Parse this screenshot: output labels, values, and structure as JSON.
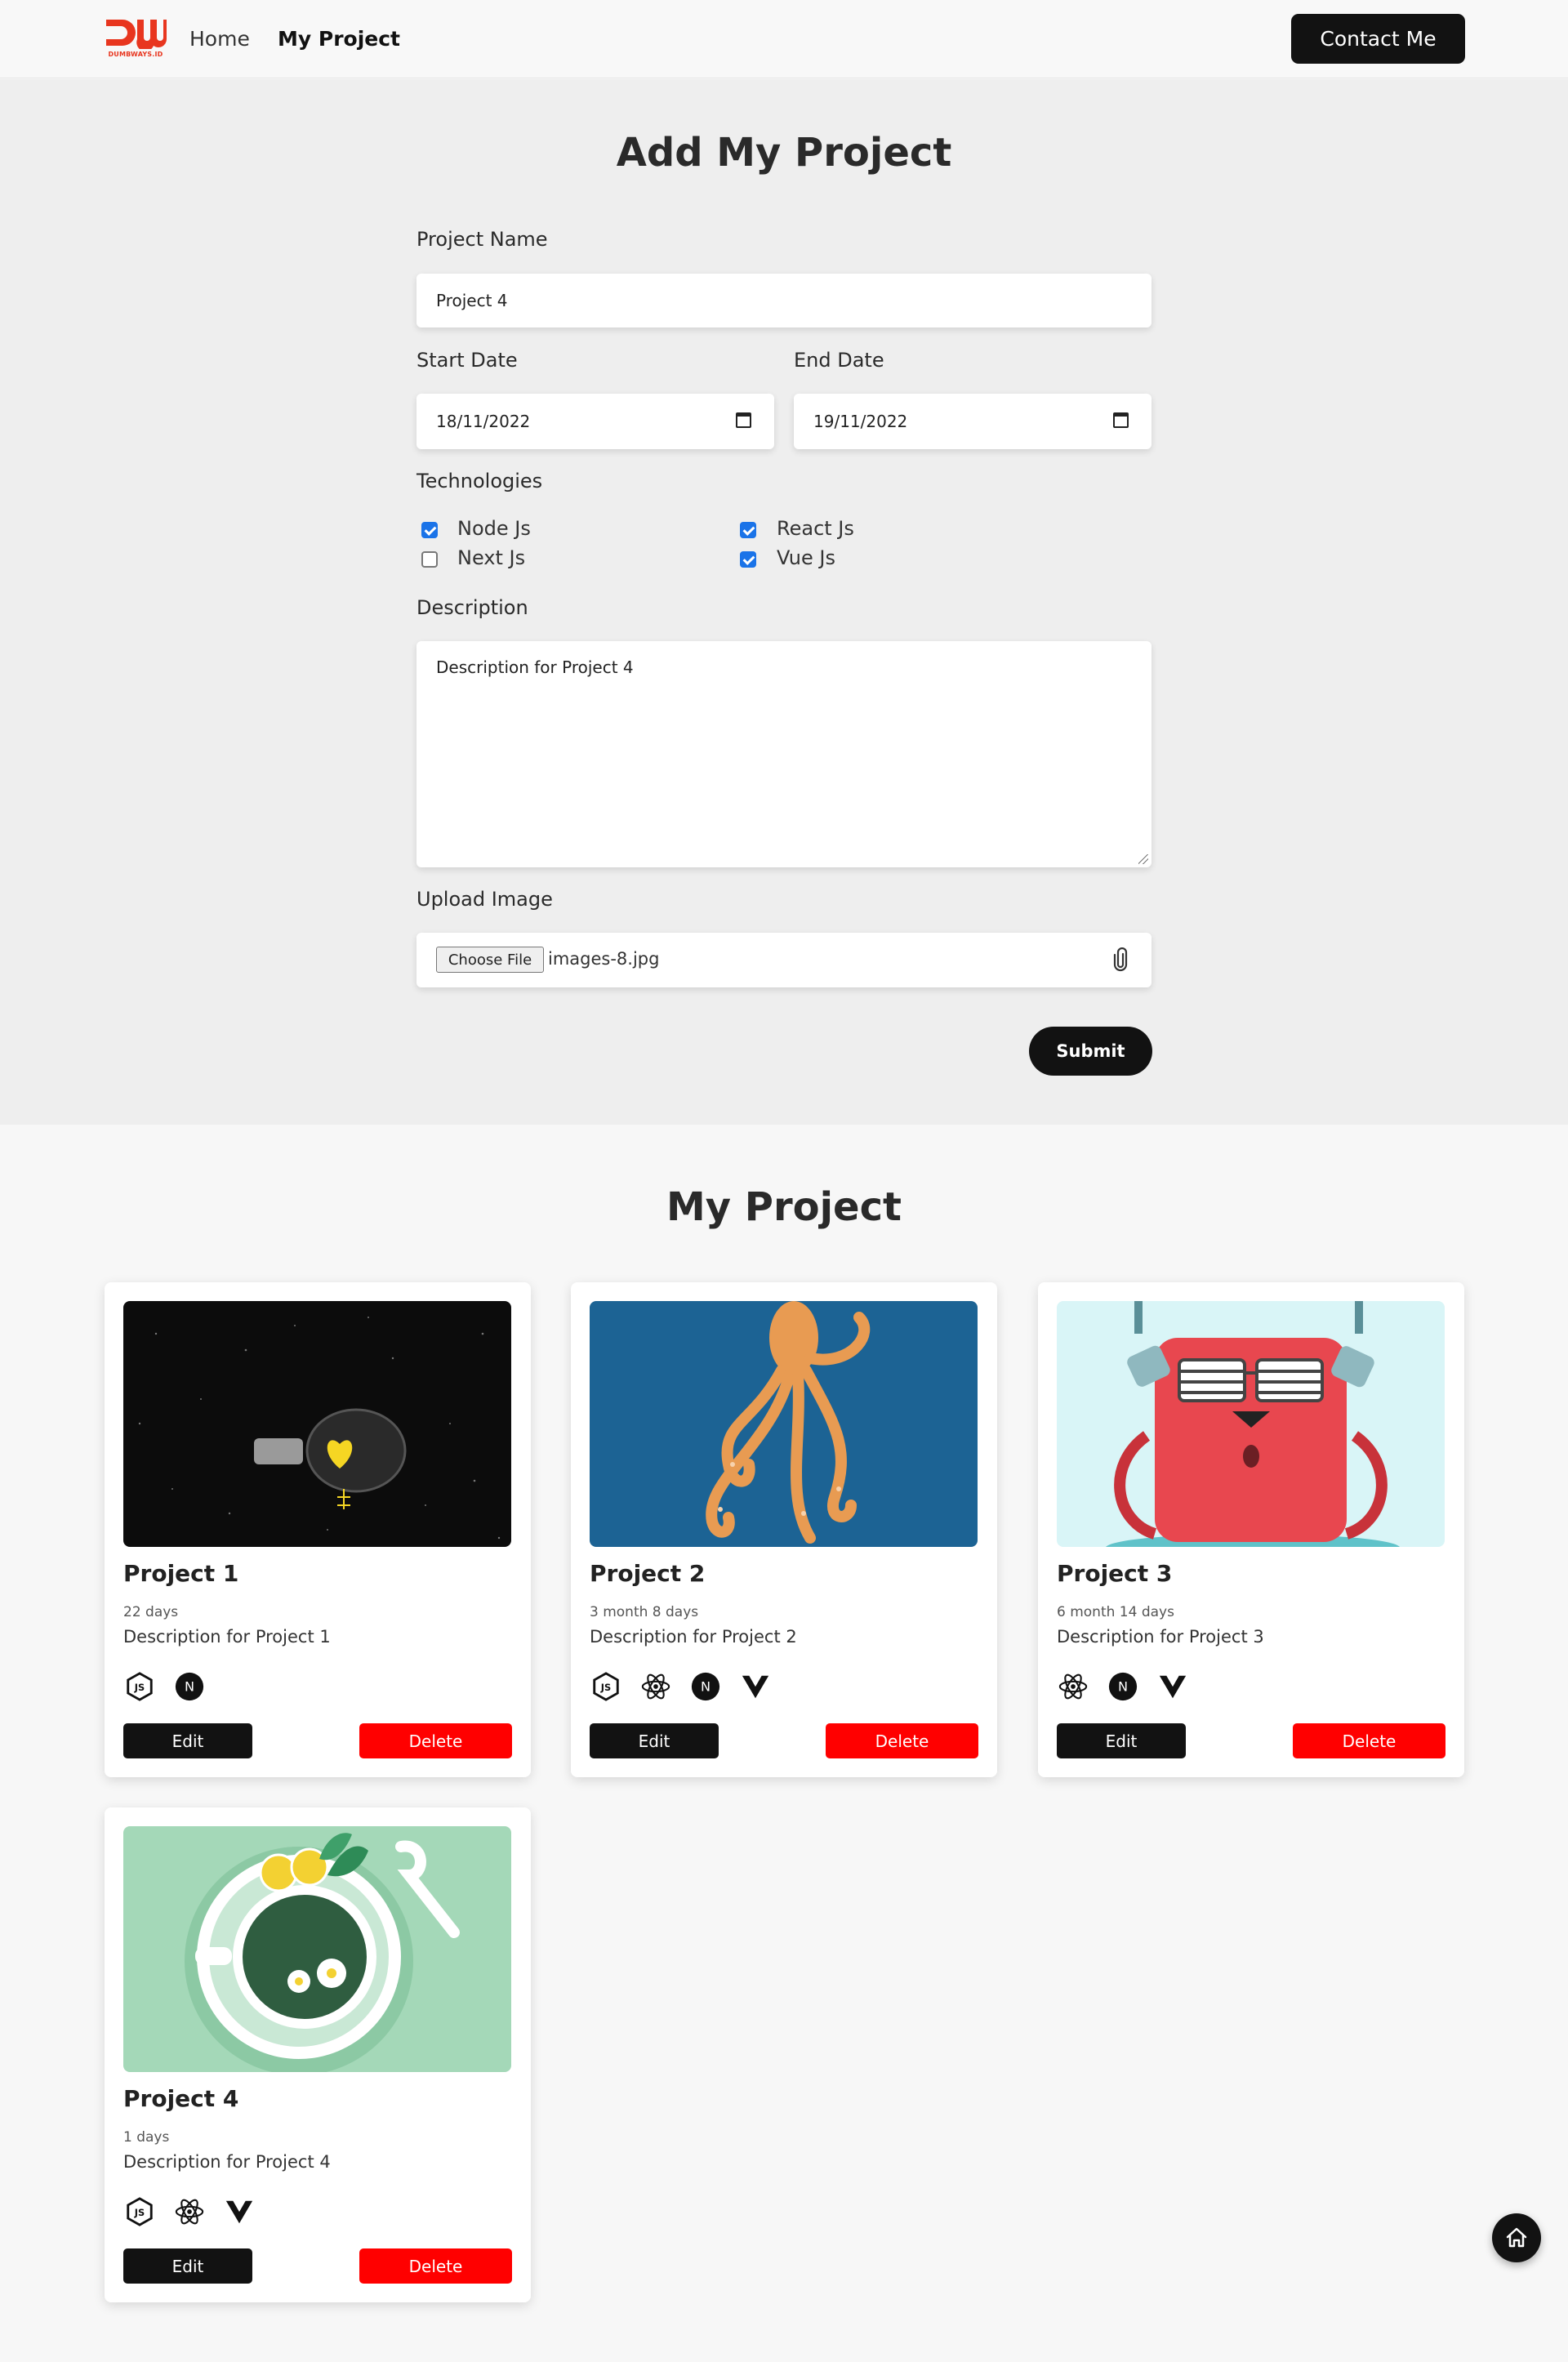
{
  "nav": {
    "logo_text": "DUMBWAYS.ID",
    "links": [
      {
        "label": "Home"
      },
      {
        "label": "My Project"
      }
    ],
    "contact_label": "Contact Me"
  },
  "form": {
    "title": "Add My Project",
    "project_name_label": "Project Name",
    "project_name_value": "Project 4",
    "start_date_label": "Start Date",
    "start_date_value": "18/11/2022",
    "end_date_label": "End Date",
    "end_date_value": "19/11/2022",
    "technologies_label": "Technologies",
    "technologies": [
      {
        "label": "Node Js",
        "checked": true
      },
      {
        "label": "React Js",
        "checked": true
      },
      {
        "label": "Next Js",
        "checked": false
      },
      {
        "label": "Vue Js",
        "checked": true
      }
    ],
    "description_label": "Description",
    "description_value": "Description for Project 4",
    "upload_label": "Upload Image",
    "choose_file_label": "Choose File",
    "file_name": "images-8.jpg",
    "submit_label": "Submit"
  },
  "projects": {
    "title": "My Project",
    "cards": [
      {
        "name": "Project 1",
        "duration": "22 days",
        "description": "Description for Project 1",
        "techs": [
          "node-js-icon",
          "next-js-icon"
        ],
        "edit": "Edit",
        "delete": "Delete"
      },
      {
        "name": "Project 2",
        "duration": "3 month 8 days",
        "description": "Description for Project 2",
        "techs": [
          "node-js-icon",
          "react-js-icon",
          "next-js-icon",
          "vue-js-icon"
        ],
        "edit": "Edit",
        "delete": "Delete"
      },
      {
        "name": "Project 3",
        "duration": "6 month 14 days",
        "description": "Description for Project 3",
        "techs": [
          "react-js-icon",
          "next-js-icon",
          "vue-js-icon"
        ],
        "edit": "Edit",
        "delete": "Delete"
      },
      {
        "name": "Project 4",
        "duration": "1 days",
        "description": "Description for Project 4",
        "techs": [
          "node-js-icon",
          "react-js-icon",
          "vue-js-icon"
        ],
        "edit": "Edit",
        "delete": "Delete"
      }
    ]
  },
  "colors": {
    "brand": "#e8361f",
    "dark": "#121212",
    "danger": "#ff0000",
    "checkbox": "#1a73e8"
  }
}
